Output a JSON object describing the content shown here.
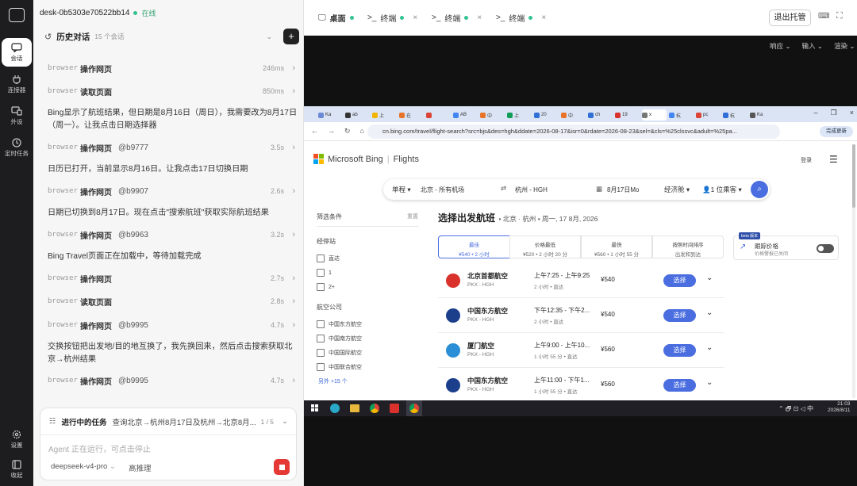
{
  "rail": {
    "items": [
      {
        "label": "会话"
      },
      {
        "label": "连接器"
      },
      {
        "label": "外设"
      },
      {
        "label": "定时任务"
      },
      {
        "label": "设置"
      },
      {
        "label": "收起"
      }
    ]
  },
  "chat": {
    "device_name": "desk-0b5303e70522bb14",
    "status": "在线",
    "history_title": "历史对话",
    "history_count": "15 个会话",
    "steps": [
      {
        "tool": "browser",
        "action": "操作网页",
        "ref": "",
        "duration": "246ms"
      },
      {
        "tool": "browser",
        "action": "读取页面",
        "ref": "",
        "duration": "850ms"
      },
      {
        "tool": "browser",
        "action": "操作网页",
        "ref": "@b9777",
        "duration": "3.5s"
      },
      {
        "tool": "browser",
        "action": "操作网页",
        "ref": "@b9907",
        "duration": "2.6s"
      },
      {
        "tool": "browser",
        "action": "操作网页",
        "ref": "@b9963",
        "duration": "3.2s"
      },
      {
        "tool": "browser",
        "action": "操作网页",
        "ref": "",
        "duration": "2.7s"
      },
      {
        "tool": "browser",
        "action": "读取页面",
        "ref": "",
        "duration": "2.8s"
      },
      {
        "tool": "browser",
        "action": "操作网页",
        "ref": "@b9995",
        "duration": "4.7s"
      },
      {
        "tool": "browser",
        "action": "操作网页",
        "ref": "@b9995",
        "duration": "4.7s"
      }
    ],
    "messages": [
      "Bing显示了航班结果，但日期是8月16日（周日），我需要改为8月17日（周一）。让我点击日期选择器",
      "日历已打开，当前显示8月16日。让我点击17日切换日期",
      "日期已切换到8月17日。现在点击\"搜索航班\"获取实际航班结果",
      "Bing Travel页面正在加载中，等待加载完成",
      "交换按钮把出发地/目的地互换了，我先换回来，然后点击搜索获取北京→杭州结果"
    ],
    "task_label": "进行中的任务",
    "task_text": "查询北京→杭州8月17日及杭州→北京8月...",
    "task_progress": "1 / 5",
    "input_placeholder": "Agent 正在运行，可点击停止",
    "model": "deepseek-v4-pro",
    "reasoning": "高推理"
  },
  "top": {
    "tabs": [
      {
        "label": "桌面"
      },
      {
        "label": "终端"
      },
      {
        "label": "终端"
      },
      {
        "label": "终端"
      }
    ],
    "release_button": "退出托管",
    "menu": [
      "响应",
      "输入",
      "渲染"
    ]
  },
  "browser": {
    "url": "cn.bing.com/travel/flight-search?src=bjs&des=hgh&ddate=2026-08-17&isr=0&rdate=2026-08-23&sel=&cls=%25clssvc&adult=%25pa...",
    "tabs": [
      "Ka",
      "ab",
      "上",
      "在",
      "",
      "AB",
      "中",
      "上",
      "20",
      "中",
      "ch",
      "19",
      "x",
      "杭",
      "pc",
      "杭",
      "Ka"
    ],
    "update_btn": "完成更新",
    "brand": "Microsoft Bing",
    "brand_section": "Flights",
    "login": "登录",
    "search": {
      "trip": "单程",
      "from": "北京 - 所有机场",
      "to": "杭州 - HGH",
      "date": "8月17日Mo",
      "cabin": "经济舱",
      "pax": "1 位乘客"
    },
    "filter_title": "筛选条件",
    "filter_reset": "重置",
    "stops_title": "经停站",
    "stops": [
      "直达",
      "1",
      "2+"
    ],
    "airlines_title": "航空公司",
    "airlines": [
      "中国东方航空",
      "中国南方航空",
      "中国国际航空",
      "中国联合航空"
    ],
    "more_airlines": "另外 +15 个",
    "results_title": "选择出发航班",
    "results_route": "• 北京 · 杭州 • 周一, 17 8月, 2026",
    "sort": [
      {
        "title": "最佳",
        "sub": "¥540 • 2 小时"
      },
      {
        "title": "价格最低",
        "sub": "¥520 • 2 小时 20 分"
      },
      {
        "title": "最快",
        "sub": "¥560 • 1 小时 55 分"
      },
      {
        "title": "按照时间排序",
        "sub": "出发和到达"
      }
    ],
    "track": {
      "badge": "beta 版本",
      "title": "跟踪价格",
      "sub": "价格警报已关闭"
    },
    "flights": [
      {
        "airline": "北京首都航空",
        "route": "PKX - HGH",
        "time": "上午7:25 - 上午9:25",
        "dur": "2 小时 • 直达",
        "price": "¥540",
        "select": "选择"
      },
      {
        "airline": "中国东方航空",
        "route": "PKX - HGH",
        "time": "下午12:35 - 下午2...",
        "dur": "2 小时 • 直达",
        "price": "¥540",
        "select": "选择"
      },
      {
        "airline": "厦门航空",
        "route": "PKX - HGH",
        "time": "上午9:00 - 上午10...",
        "dur": "1 小时 55 分 • 直达",
        "price": "¥560",
        "select": "选择"
      },
      {
        "airline": "中国东方航空",
        "route": "PKX - HGH",
        "time": "上午11:00 - 下午1...",
        "dur": "1 小时 55 分 • 直达",
        "price": "¥560",
        "select": "选择"
      }
    ]
  },
  "taskbar": {
    "time": "21:03",
    "date": "2026/8/11",
    "ime": "中"
  },
  "colors": {
    "accent": "#4a6ee0",
    "online": "#34c38f"
  }
}
